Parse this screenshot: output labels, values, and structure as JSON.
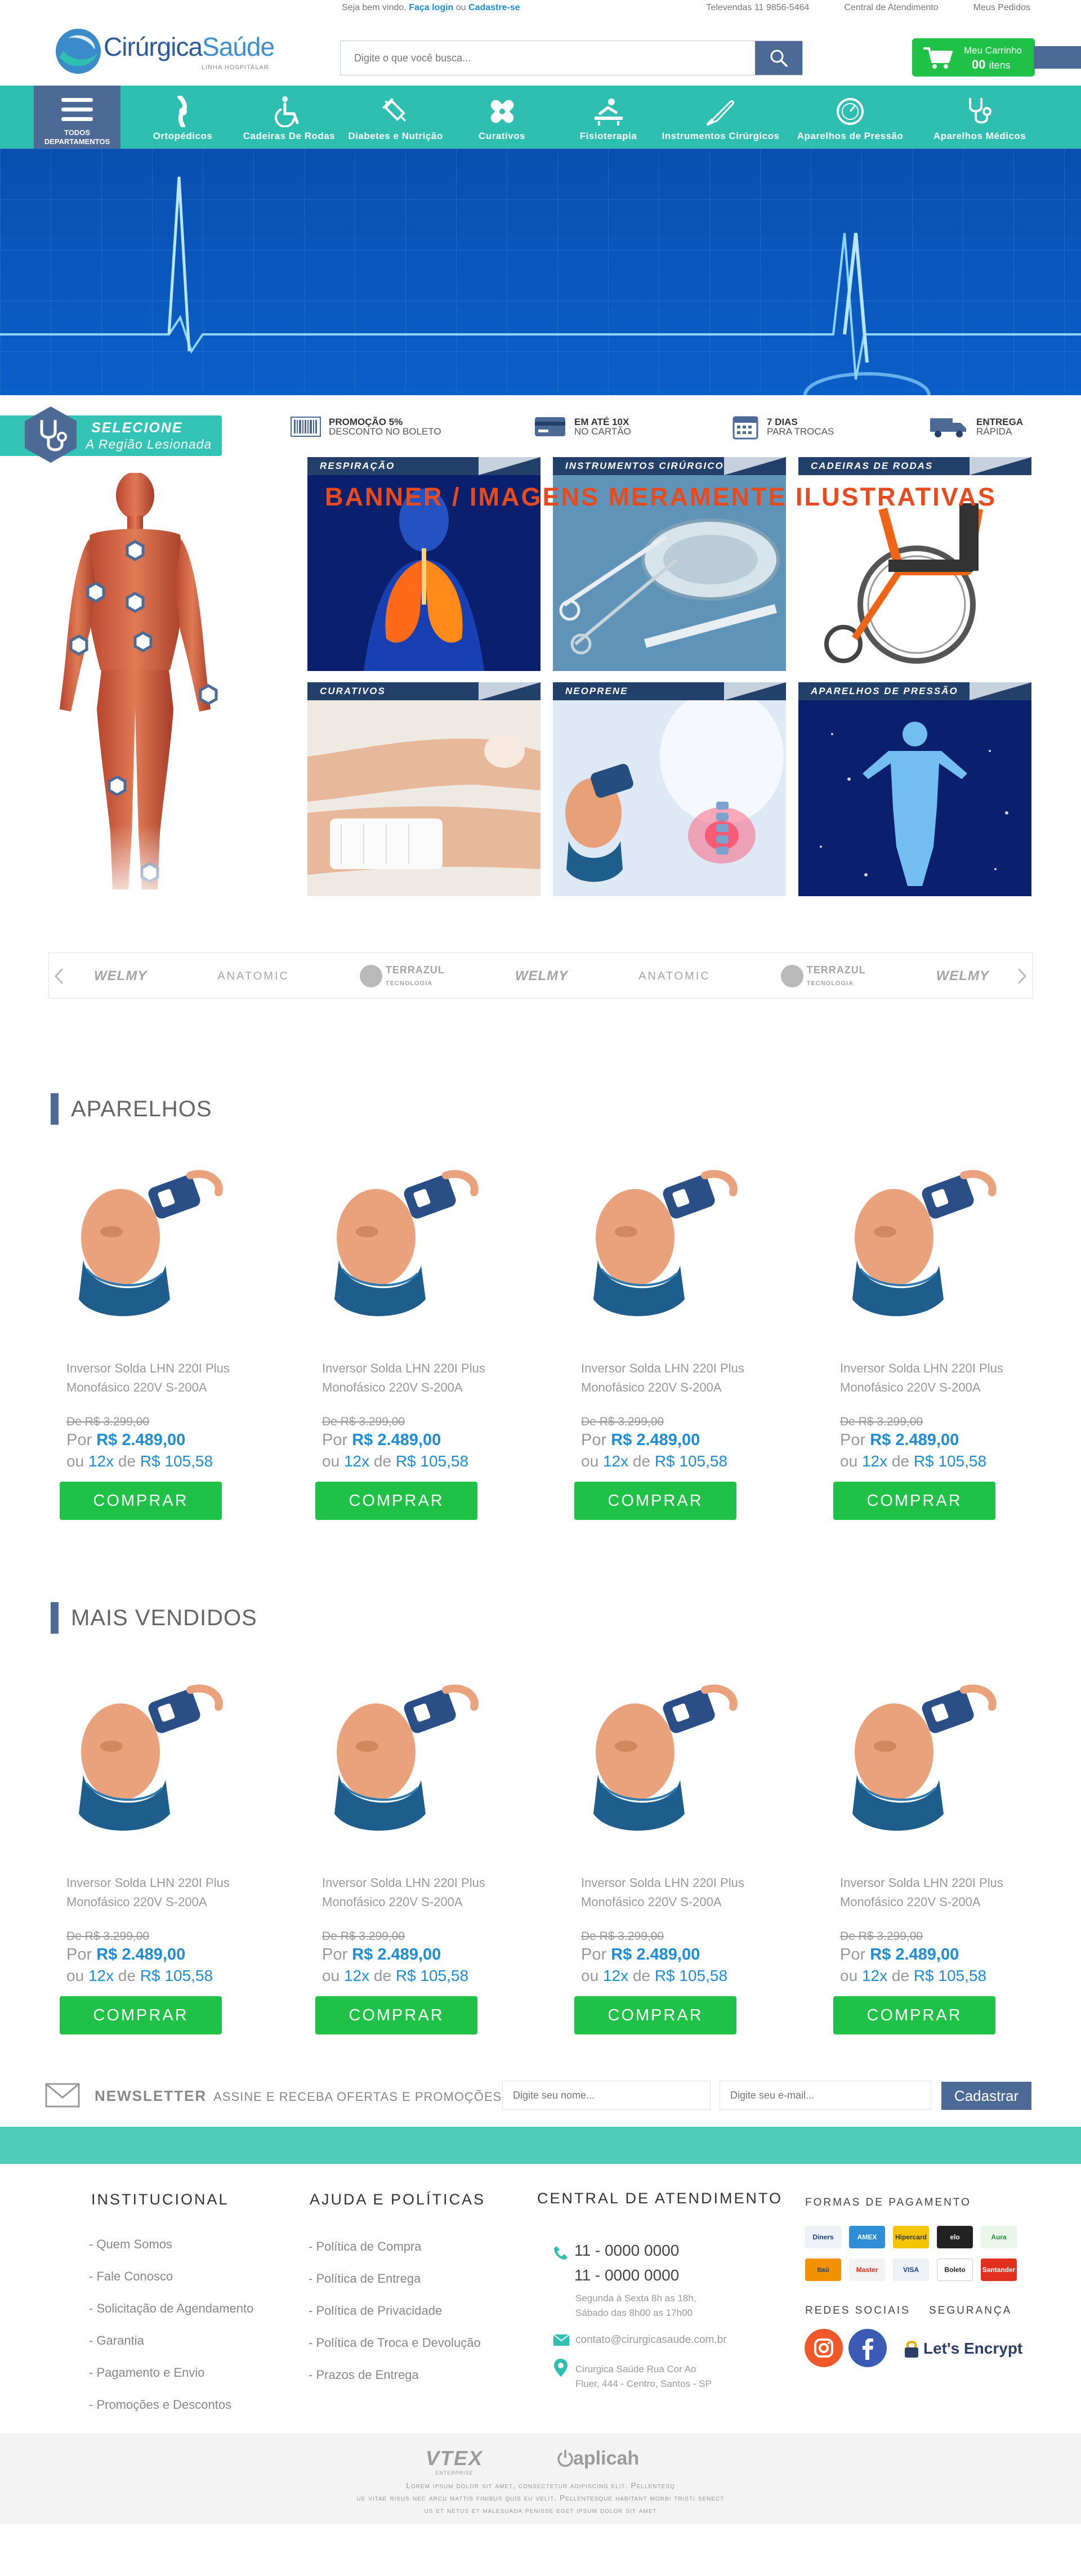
{
  "topbar": {
    "welcome_prefix": "Seja bem vindo,",
    "login": "Faça login",
    "or": "ou",
    "register": "Cadastre-se",
    "links": [
      "Televendas 11 9856-5464",
      "Central de Atendimento",
      "Meus Pedidos"
    ]
  },
  "header": {
    "logo_name_a": "Cirúrgica",
    "logo_name_b": "Saúde",
    "logo_tag": "LINHA HOSPITALAR",
    "search_placeholder": "Digite o que você busca...",
    "cart_title": "Meu Carrinho",
    "cart_count": "00",
    "cart_unit": "itens"
  },
  "nav": {
    "all_label_1": "TODOS",
    "all_label_2": "DEPARTAMENTOS",
    "items": [
      {
        "label": "Ortopédicos",
        "icon": "knee-icon"
      },
      {
        "label": "Cadeiras De Rodas",
        "icon": "wheelchair-icon"
      },
      {
        "label": "Diabetes e Nutrição",
        "icon": "syringe-icon"
      },
      {
        "label": "Curativos",
        "icon": "bandage-icon"
      },
      {
        "label": "Fisioterapia",
        "icon": "physio-icon"
      },
      {
        "label": "Instrumentos Cirúrgicos",
        "icon": "scalpel-icon"
      },
      {
        "label": "Aparelhos de Pressão",
        "icon": "gauge-icon"
      },
      {
        "label": "Aparelhos Médicos",
        "icon": "stethoscope-icon"
      }
    ]
  },
  "selector": {
    "line1": "SELECIONE",
    "line2": "A Região Lesionada"
  },
  "benefits": [
    {
      "bold": "PROMOÇÃO 5%",
      "text": "DESCONTO NO BOLETO",
      "icon": "barcode-icon"
    },
    {
      "bold": "EM ATÉ 10X",
      "text": "NO CARTÃO",
      "icon": "credit-card-icon"
    },
    {
      "bold": "7 DIAS",
      "text": "PARA TROCAS",
      "icon": "calendar-icon"
    },
    {
      "bold": "ENTREGA",
      "text": "RÁPIDA",
      "icon": "truck-icon"
    }
  ],
  "overlay_text": "BANNER / IMAGENS MERAMENTE ILUSTRATIVAS",
  "tiles": [
    "RESPIRAÇÃO",
    "INSTRUMENTOS CIRÚRGICOS",
    "CADEIRAS DE RODAS",
    "CURATIVOS",
    "NEOPRENE",
    "APARELHOS DE PRESSÃO"
  ],
  "brands": [
    "WELMY",
    "ANATOMIC",
    "TERRAZUL",
    "WELMY",
    "ANATOMIC",
    "TERRAZUL",
    "WELMY"
  ],
  "brand_sub": "TECNOLOGIA",
  "sections": [
    {
      "title": "APARELHOS"
    },
    {
      "title": "MAIS VENDIDOS"
    }
  ],
  "product": {
    "name": "Inversor Solda LHN 220I Plus Monofásico 220V S-200A",
    "old_price": "De R$ 3.299,00",
    "por": "Por",
    "price": "R$ 2.489,00",
    "inst_prefix": "ou",
    "inst_count": "12x",
    "inst_de": "de",
    "inst_value": "R$ 105,58",
    "buy": "COMPRAR"
  },
  "newsletter": {
    "title": "NEWSLETTER",
    "subtitle": "ASSINE E RECEBA OFERTAS E PROMOÇÕES",
    "name_placeholder": "Digite seu nome...",
    "email_placeholder": "Digite seu e-mail...",
    "button": "Cadastrar"
  },
  "footer": {
    "institucional": {
      "title": "INSTITUCIONAL",
      "links": [
        "- Quem Somos",
        "- Fale Conosco",
        "- Solicitação de Agendamento",
        "- Garantia",
        "- Pagamento e Envio",
        "- Promoções e Descontos"
      ]
    },
    "ajuda": {
      "title": "AJUDA E POLÍTICAS",
      "links": [
        "- Política de Compra",
        "- Política de Entrega",
        "- Política de Privacidade",
        "- Política de Troca e Devolução",
        "- Prazos de Entrega"
      ]
    },
    "central": {
      "title": "CENTRAL DE ATENDIMENTO",
      "phone1": "11 - 0000 0000",
      "phone2": "11 - 0000 0000",
      "hours1": "Segunda à Sexta 8h as 18h,",
      "hours2": "Sábado das 8h00 as 17h00",
      "email": "contato@cirurgicasaude.com.br",
      "addr1": "Cirurgica Saúde Rua Cor Ao",
      "addr2": "Fluer, 444 - Centro, Santos - SP"
    },
    "pay_title": "FORMAS DE PAGAMENTO",
    "cards": [
      "Diners",
      "AMEX",
      "Hipercard",
      "elo",
      "Aura",
      "Itaú",
      "Master",
      "VISA",
      "Boleto",
      "Santander"
    ],
    "social_title": "REDES SOCIAIS",
    "security_title": "SEGURANÇA",
    "security_badge": "Let's Encrypt",
    "vtex": "VTEX",
    "vtex_sub": "ENTERPRISE",
    "aplicah": "aplicah",
    "lorem1": "Lorem ipsum dolor sit amet, consectetur adipiscing elit. Pellentesq",
    "lorem2": "ue vitae risus nec arcu mattis finibus quis eu velit. Pellentesque habitant morbi tristi senect",
    "lorem3": "us et netus et malesuada penisse eget ipsum dolor sit amet"
  },
  "colors": {
    "teal": "#2fbfb0",
    "navy": "#4c6a95",
    "green": "#1fc247",
    "blue_price": "#1f8dd6"
  }
}
